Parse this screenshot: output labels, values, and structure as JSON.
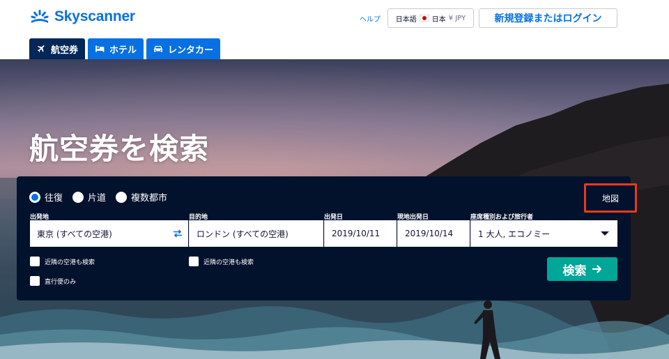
{
  "header": {
    "logo_text": "Skyscanner",
    "help": "ヘルプ",
    "locale": {
      "language": "日本語",
      "country": "日本",
      "currency": "¥ JPY"
    },
    "login": "新規登録またはログイン"
  },
  "tabs": [
    {
      "label": "航空券",
      "icon": "plane-icon",
      "active": true
    },
    {
      "label": "ホテル",
      "icon": "bed-icon",
      "active": false
    },
    {
      "label": "レンタカー",
      "icon": "car-icon",
      "active": false
    }
  ],
  "hero": {
    "title": "航空券を検索"
  },
  "search": {
    "trip_types": [
      {
        "label": "往復",
        "checked": true
      },
      {
        "label": "片道",
        "checked": false
      },
      {
        "label": "複数都市",
        "checked": false
      }
    ],
    "map_button": "地図",
    "fields": {
      "origin": {
        "label": "出発地",
        "value": "東京 (すべての空港)"
      },
      "destination": {
        "label": "目的地",
        "value": "ロンドン (すべての空港)"
      },
      "depart": {
        "label": "出発日",
        "value": "2019/10/11"
      },
      "return": {
        "label": "現地出発日",
        "value": "2019/10/14"
      },
      "cabin": {
        "label": "座席種別および旅行者",
        "value": "1 大人, エコノミー"
      }
    },
    "nearby_origin": "近隣の空港も検索",
    "nearby_destination": "近隣の空港も検索",
    "direct_only": "直行便のみ",
    "submit": "検索"
  },
  "colors": {
    "brand": "#0770e3",
    "panel": "#02122c",
    "search_button": "#00a698",
    "highlight": "#e83a1e"
  }
}
